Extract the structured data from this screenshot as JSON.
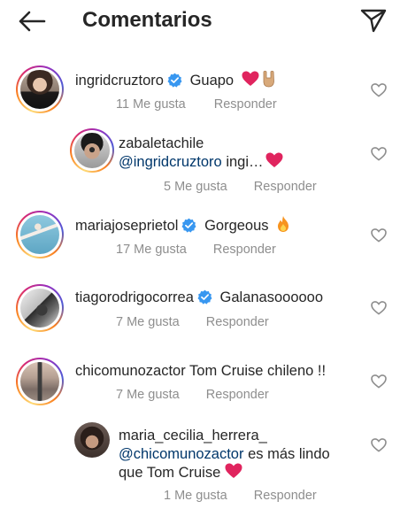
{
  "header": {
    "title": "Comentarios",
    "back_icon": "arrow-left-icon",
    "share_icon": "paper-plane-icon"
  },
  "colors": {
    "mention": "#00376b",
    "meta": "#8e8e8e",
    "verified": "#3897f0",
    "heart_emoji": "#e0245e"
  },
  "comments": [
    {
      "username": "ingridcruztoro",
      "verified": true,
      "text": "Guapo",
      "emojis": [
        "red-heart",
        "rock-hand"
      ],
      "likes": "11 Me gusta",
      "reply": "Responder"
    },
    {
      "username": "zabaletachile",
      "verified": false,
      "mention": "@ingridcruztoro",
      "text": "ingi…",
      "emojis": [
        "red-heart"
      ],
      "likes": "5 Me gusta",
      "reply": "Responder"
    },
    {
      "username": "mariajoseprietol",
      "verified": true,
      "text": "Gorgeous",
      "emojis": [
        "fire"
      ],
      "likes": "17 Me gusta",
      "reply": "Responder"
    },
    {
      "username": "tiagorodrigocorrea",
      "verified": true,
      "text": "Galanasoooooo",
      "likes": "7 Me gusta",
      "reply": "Responder"
    },
    {
      "username": "chicomunozactor",
      "verified": false,
      "text": "Tom Cruise chileno !!",
      "likes": "7 Me gusta",
      "reply": "Responder"
    },
    {
      "username": "maria_cecilia_herrera_",
      "verified": false,
      "mention": "@chicomunozactor",
      "text": "es más lindo",
      "text2": "que Tom Cruise",
      "emojis": [
        "red-heart"
      ],
      "likes": "1 Me gusta",
      "reply": "Responder"
    }
  ]
}
